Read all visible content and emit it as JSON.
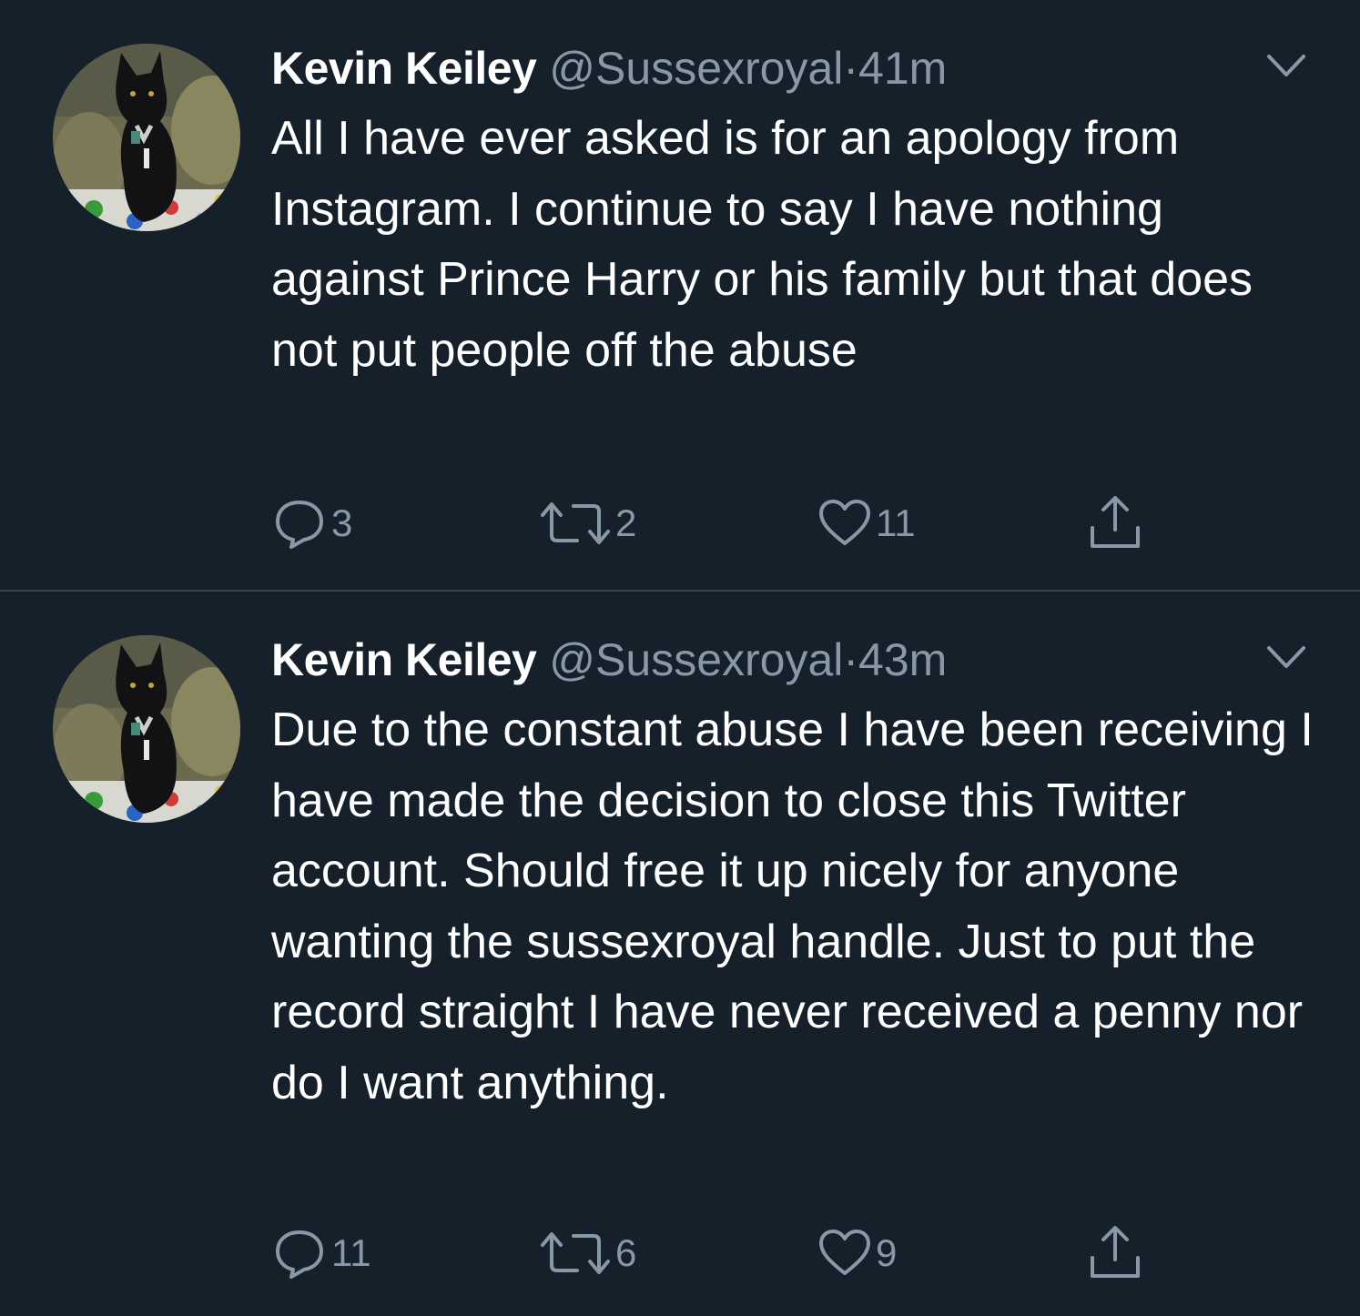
{
  "colors": {
    "background": "#15202b",
    "text_primary": "#ffffff",
    "text_secondary": "#8899a6",
    "divider": "#38444d"
  },
  "icons": {
    "reply": "speech-bubble-icon",
    "retweet": "retweet-arrows-icon",
    "like": "heart-icon",
    "share": "share-upload-icon",
    "menu": "chevron-down-icon"
  },
  "tweets": [
    {
      "display_name": "Kevin Keiley",
      "handle": "@Sussexroyal",
      "separator": "·",
      "time": "41m",
      "text": "All I have ever asked is for an apology from Instagram. I continue to say I have nothing against Prince Harry or his family but that does not put people off the abuse",
      "replies": "3",
      "retweets": "2",
      "likes": "11"
    },
    {
      "display_name": "Kevin Keiley",
      "handle": "@Sussexroyal",
      "separator": "·",
      "time": "43m",
      "text": "Due to the constant abuse I have been receiving I have made the decision to close this Twitter account. Should free it up nicely for anyone wanting the sussexroyal handle. Just to put the record straight I have never received a penny nor do I want anything.",
      "replies": "11",
      "retweets": "6",
      "likes": "9"
    }
  ]
}
